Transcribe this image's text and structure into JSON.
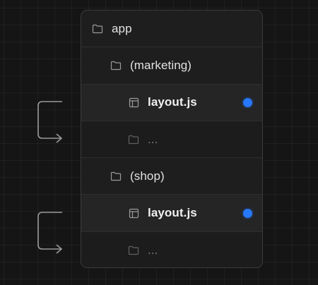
{
  "colors": {
    "accent_dot": "#2678ff",
    "folder_icon": "#9a9a9a",
    "connector": "#9a9a9a"
  },
  "tree": [
    {
      "label": "app",
      "icon": "folder-icon",
      "level": 0,
      "style": "normal"
    },
    {
      "label": "(marketing)",
      "icon": "folder-icon",
      "level": 1,
      "style": "normal"
    },
    {
      "label": "layout.js",
      "icon": "layout-file-icon",
      "level": 2,
      "style": "bold",
      "dot": true
    },
    {
      "label": "...",
      "icon": "folder-icon",
      "level": 2,
      "style": "muted"
    },
    {
      "label": "(shop)",
      "icon": "folder-icon",
      "level": 1,
      "style": "normal"
    },
    {
      "label": "layout.js",
      "icon": "layout-file-icon",
      "level": 2,
      "style": "bold",
      "dot": true
    },
    {
      "label": "...",
      "icon": "folder-icon",
      "level": 2,
      "style": "muted"
    }
  ]
}
